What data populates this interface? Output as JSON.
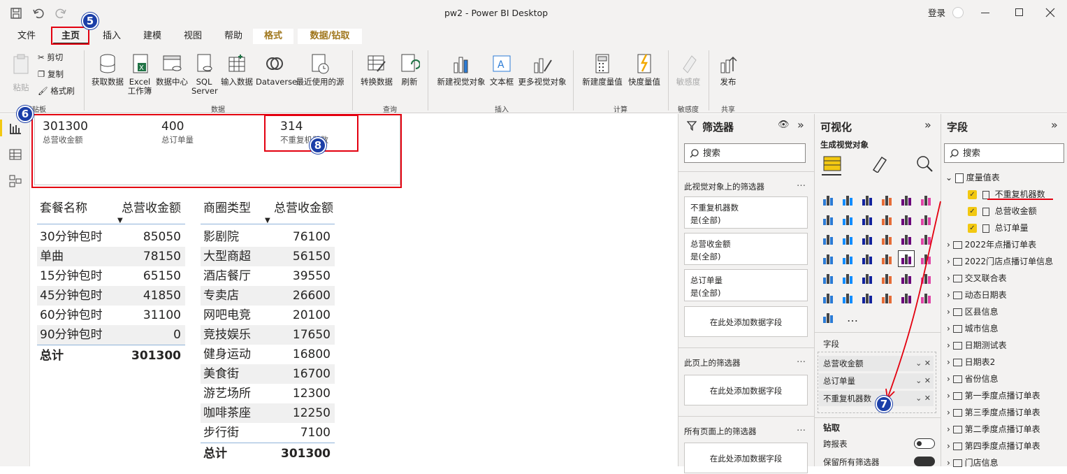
{
  "window": {
    "title": "pw2 - Power BI Desktop",
    "login": "登录"
  },
  "tabs": [
    "文件",
    "主页",
    "插入",
    "建模",
    "视图",
    "帮助",
    "格式",
    "数据/钻取"
  ],
  "ribbon": {
    "clipboard": {
      "paste": "粘贴",
      "cut": "剪切",
      "copy": "复制",
      "format_painter": "格式刷",
      "group": "剪贴板"
    },
    "data": {
      "get_data": "获取数据",
      "excel": "Excel 工作簿",
      "datahub": "数据中心",
      "sql": "SQL Server",
      "enter": "输入数据",
      "dataverse": "Dataverse",
      "recent": "最近使用的源",
      "group": "数据"
    },
    "query": {
      "transform": "转换数据",
      "refresh": "刷新",
      "group": "查询"
    },
    "insert": {
      "new_visual": "新建视觉对象",
      "textbox": "文本框",
      "more_visuals": "更多视觉对象",
      "group": "插入"
    },
    "calc": {
      "new_measure": "新建度量值",
      "quick_measure": "快度量值",
      "group": "计算"
    },
    "sensitivity": {
      "label": "敏感度",
      "group": "敏感度"
    },
    "share": {
      "publish": "发布",
      "group": "共享"
    }
  },
  "cards": [
    {
      "value": "301300",
      "label": "总营收金额"
    },
    {
      "value": "400",
      "label": "总订单量"
    },
    {
      "value": "314",
      "label": "不重复机器数"
    }
  ],
  "table1": {
    "headers": [
      "套餐名称",
      "总营收金额"
    ],
    "rows": [
      [
        "30分钟包时",
        "85050"
      ],
      [
        "单曲",
        "78150"
      ],
      [
        "15分钟包时",
        "65150"
      ],
      [
        "45分钟包时",
        "41850"
      ],
      [
        "60分钟包时",
        "31100"
      ],
      [
        "90分钟包时",
        "0"
      ]
    ],
    "total": [
      "总计",
      "301300"
    ]
  },
  "table2": {
    "headers": [
      "商圈类型",
      "总营收金额"
    ],
    "rows": [
      [
        "影剧院",
        "76100"
      ],
      [
        "大型商超",
        "56150"
      ],
      [
        "酒店餐厅",
        "39550"
      ],
      [
        "专卖店",
        "26600"
      ],
      [
        "网吧电竞",
        "20100"
      ],
      [
        "竞技娱乐",
        "17650"
      ],
      [
        "健身运动",
        "16800"
      ],
      [
        "美食街",
        "16700"
      ],
      [
        "游艺场所",
        "12300"
      ],
      [
        "咖啡茶座",
        "12250"
      ],
      [
        "步行街",
        "7100"
      ]
    ],
    "total": [
      "总计",
      "301300"
    ]
  },
  "filters": {
    "title": "筛选器",
    "search": "搜索",
    "visual_section": "此视觉对象上的筛选器",
    "cards": [
      {
        "name": "不重复机器数",
        "state": "是(全部)"
      },
      {
        "name": "总营收金额",
        "state": "是(全部)"
      },
      {
        "name": "总订单量",
        "state": "是(全部)"
      }
    ],
    "add_field": "在此处添加数据字段",
    "page_section": "此页上的筛选器",
    "all_section": "所有页面上的筛选器"
  },
  "viz": {
    "title": "可视化",
    "build": "生成视觉对象",
    "fields_label": "字段",
    "fields": [
      "总营收金额",
      "总订单量",
      "不重复机器数"
    ],
    "drill": "钻取",
    "cross_report": "跨报表",
    "keep_filters": "保留所有筛选器",
    "more": "…"
  },
  "fieldpane": {
    "title": "字段",
    "search": "搜索",
    "measure_table": "度量值表",
    "measures": [
      "不重复机器数",
      "总营收金额",
      "总订单量"
    ],
    "tables": [
      "2022年点播订单表",
      "2022门店点播订单信息",
      "交叉联合表",
      "动态日期表",
      "区县信息",
      "城市信息",
      "日期测试表",
      "日期表2",
      "省份信息",
      "第一季度点播订单表",
      "第三季度点播订单表",
      "第二季度点播订单表",
      "第四季度点播订单表",
      "门店信息"
    ]
  },
  "badges": [
    "5",
    "6",
    "7",
    "8"
  ]
}
